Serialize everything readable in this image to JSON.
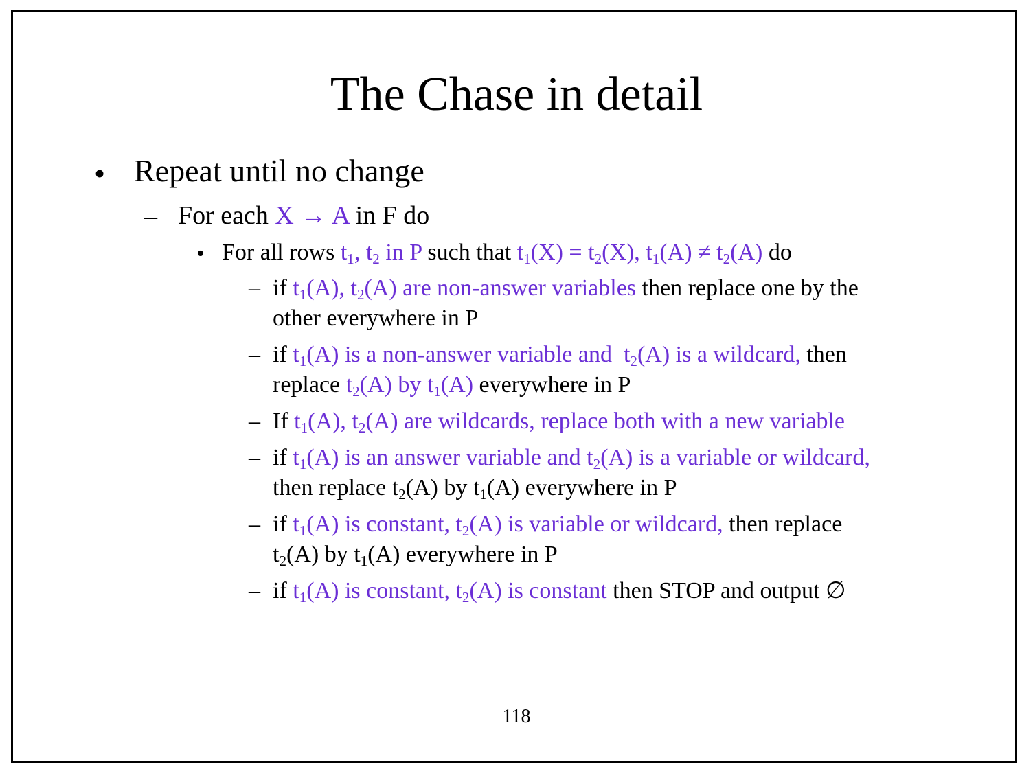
{
  "slide": {
    "title": "The Chase in detail",
    "page_number": "118",
    "accent_color": "#6b2fd6",
    "bullet_marker": "•",
    "dash_marker": "–"
  },
  "level1": {
    "text": "Repeat until no change"
  },
  "level2": {
    "text_plain": "For each",
    "text_fd": "X → A",
    "text_tail": "in F do"
  },
  "level3": {
    "p1": "For all rows",
    "t": "t",
    "s1": "1",
    "s2": "2",
    "comma": ",",
    "p2": "in P",
    "p3": "such that",
    "eqX": "(X) =",
    "X": "(X),",
    "A_neq": "(A) ≠",
    "A": "(A)",
    "p4": "do"
  },
  "rules": [
    {
      "if": "if",
      "r1_a": "(A),",
      "r1_b": "(A) are non-answer variables",
      "r1_c": "then replace one by the",
      "r1_d": "other everywhere in P"
    },
    {
      "if": "if",
      "r2_a": "(A) is a non-answer variable and",
      "r2_b": "(A) is a wildcard,",
      "r2_c": "then",
      "r2_d": "replace",
      "r2_e": "(A) by",
      "r2_f": "(A)",
      "r2_g": "everywhere in P"
    },
    {
      "if": "If",
      "r3_a": "(A),",
      "r3_b": "(A) are wildcards, replace both with a new variable"
    },
    {
      "if": "if",
      "r4_a": "(A) is an answer variable and",
      "r4_b": "(A) is a variable or wildcard,",
      "r4_c": "then replace",
      "r4_d": "(A) by",
      "r4_e": "(A) everywhere in P"
    },
    {
      "if": "if",
      "r5_a": "(A) is constant,",
      "r5_b": "(A) is variable or wildcard,",
      "r5_c": "then replace",
      "r5_d": "(A) by",
      "r5_e": "(A) everywhere in P"
    },
    {
      "if": "if",
      "r6_a": "(A) is constant,",
      "r6_b": "(A) is constant",
      "r6_c": "then STOP and output ∅"
    }
  ]
}
